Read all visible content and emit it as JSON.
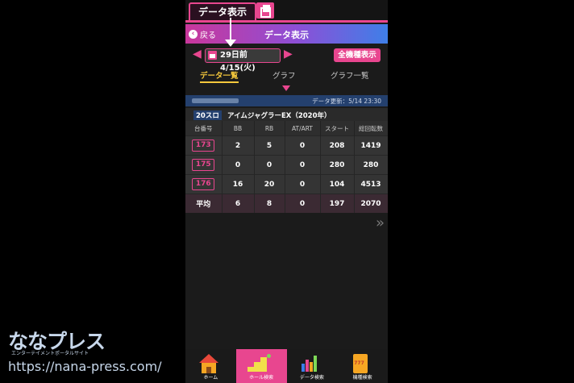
{
  "top_tabs": {
    "data_label": "データ表示"
  },
  "header": {
    "back_label": "戻る",
    "title": "データ表示"
  },
  "date_nav": {
    "prev_arrow": "◀",
    "next_arrow": "▶",
    "date_text": "29日前 4/15(火)",
    "all_models_label": "全機種表示"
  },
  "sub_tabs": [
    "データ一覧",
    "グラフ",
    "グラフ一覧"
  ],
  "update_bar": {
    "text": "データ更新：5/14 23:30"
  },
  "machine": {
    "rate_tag": "20スロ",
    "name": "アイムジャグラーEX（2020年）"
  },
  "table": {
    "headers": [
      "台番号",
      "BB",
      "RB",
      "AT/ART",
      "スタート",
      "総回転数"
    ],
    "rows": [
      [
        "173",
        "2",
        "5",
        "0",
        "208",
        "1419"
      ],
      [
        "175",
        "0",
        "0",
        "0",
        "280",
        "280"
      ],
      [
        "176",
        "16",
        "20",
        "0",
        "104",
        "4513"
      ]
    ],
    "average": [
      "平均",
      "6",
      "8",
      "0",
      "197",
      "2070"
    ]
  },
  "chevron": "»",
  "bottom_nav": [
    "ホーム",
    "ホール検索",
    "データ検索",
    "機種検索"
  ],
  "watermark": {
    "logo": "ななプレス",
    "logo_sub": "エンターテイメントポータルサイト",
    "url": "https://nana-press.com/"
  },
  "colors": {
    "accent": "#e8468f",
    "active_tab": "#f5c83c",
    "update_bar": "#24406e"
  }
}
